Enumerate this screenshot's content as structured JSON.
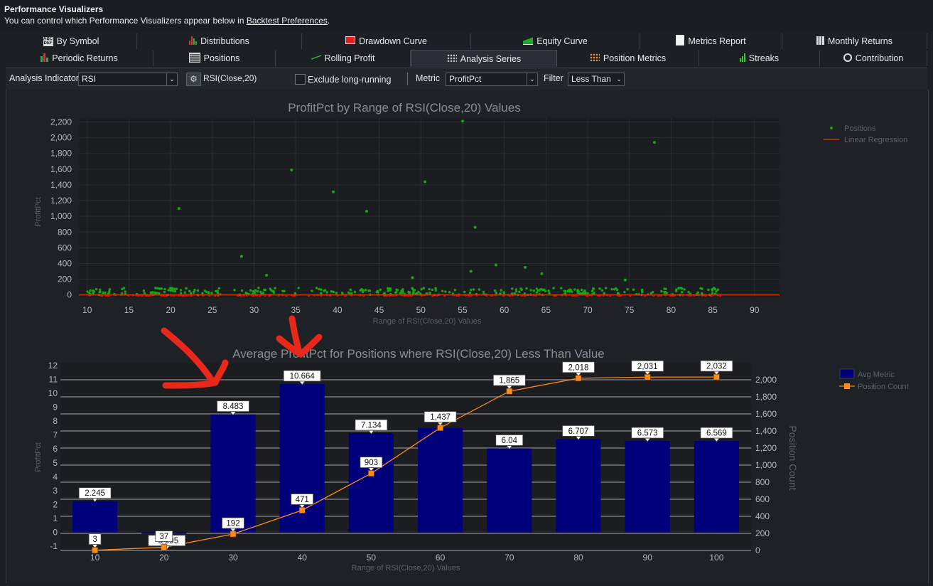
{
  "header": {
    "title": "Performance Visualizers",
    "subtitle_prefix": "You can control which Performance Visualizers appear below in ",
    "subtitle_link": "Backtest Preferences",
    "subtitle_suffix": "."
  },
  "tabs_row1": [
    {
      "label": "By Symbol",
      "icon": "abc-def-icon"
    },
    {
      "label": "Distributions",
      "icon": "bar-chart-icon"
    },
    {
      "label": "Drawdown Curve",
      "icon": "drawdown-icon"
    },
    {
      "label": "Equity Curve",
      "icon": "equity-curve-icon"
    },
    {
      "label": "Metrics Report",
      "icon": "document-icon"
    },
    {
      "label": "Monthly Returns",
      "icon": "calendar-columns-icon"
    }
  ],
  "tabs_row2": [
    {
      "label": "Periodic Returns",
      "icon": "periodic-returns-icon"
    },
    {
      "label": "Positions",
      "icon": "table-icon"
    },
    {
      "label": "Rolling Profit",
      "icon": "rolling-profit-icon"
    },
    {
      "label": "Analysis Series",
      "icon": "analysis-series-icon"
    },
    {
      "label": "Position Metrics",
      "icon": "scatter-icon"
    },
    {
      "label": "Streaks",
      "icon": "streaks-icon"
    },
    {
      "label": "Contribution",
      "icon": "pie-icon"
    }
  ],
  "toolbar": {
    "indicator_label": "Analysis Indicator",
    "indicator_value": "RSI",
    "indicator_desc": "RSI(Close,20)",
    "exclude_label": "Exclude long-running",
    "metric_label": "Metric",
    "metric_value": "ProfitPct",
    "filter_label": "Filter",
    "filter_value": "Less Than"
  },
  "colors": {
    "bar": "#00007a",
    "scatter": "#11aa11",
    "scatter_neg": "#cc1111",
    "regression": "#cc3300",
    "count_line": "#ff8c1a",
    "annotation": "#e8281a"
  },
  "chart_data": [
    {
      "type": "scatter",
      "title": "ProfitPct by Range of RSI(Close,20) Values",
      "xlabel": "Range of RSI(Close,20) Values",
      "ylabel": "ProfitPct",
      "xlim": [
        9,
        93
      ],
      "ylim": [
        -30,
        2250
      ],
      "xticks": [
        10,
        15,
        20,
        25,
        30,
        35,
        40,
        45,
        50,
        55,
        60,
        65,
        70,
        75,
        80,
        85,
        90
      ],
      "yticks": [
        0,
        200,
        400,
        600,
        800,
        1000,
        1200,
        1400,
        1600,
        1800,
        2000,
        2200
      ],
      "legend": [
        "Positions",
        "Linear Regression"
      ],
      "legend_placement": "top-right",
      "outliers": [
        {
          "x": 21,
          "y": 1100
        },
        {
          "x": 28.5,
          "y": 490
        },
        {
          "x": 31.5,
          "y": 250
        },
        {
          "x": 34.5,
          "y": 1590
        },
        {
          "x": 39.5,
          "y": 1310
        },
        {
          "x": 43.5,
          "y": 1065
        },
        {
          "x": 50.5,
          "y": 1440
        },
        {
          "x": 55,
          "y": 2210
        },
        {
          "x": 56.5,
          "y": 860
        },
        {
          "x": 59,
          "y": 380
        },
        {
          "x": 62.5,
          "y": 350
        },
        {
          "x": 78,
          "y": 1940
        },
        {
          "x": 56,
          "y": 300
        },
        {
          "x": 64.5,
          "y": 270
        },
        {
          "x": 74.5,
          "y": 190
        },
        {
          "x": 49,
          "y": 220
        }
      ],
      "regression": {
        "x": [
          9,
          93
        ],
        "y": [
          0,
          0
        ]
      }
    },
    {
      "type": "bar",
      "title": "Average ProfitPct for Positions where RSI(Close,20) Less Than Value",
      "xlabel": "Range of RSI(Close,20) Values",
      "ylabel": "ProfitPct",
      "y2label": "Position Count",
      "categories": [
        "10",
        "20",
        "30",
        "40",
        "50",
        "60",
        "70",
        "80",
        "90",
        "100"
      ],
      "series": [
        {
          "name": "Avg Metric",
          "values": [
            2.245,
            -0.095,
            8.483,
            10.664,
            7.134,
            7.5,
            6.04,
            6.707,
            6.573,
            6.569
          ]
        },
        {
          "name": "Position Count",
          "values": [
            3,
            37,
            192,
            471,
            903,
            1437,
            1865,
            2018,
            2031,
            2032
          ]
        }
      ],
      "bar_labels": [
        "2.245",
        "-0.095",
        "8.483",
        "10.664",
        "7.134",
        "",
        "6.04",
        "6.707",
        "6.573",
        "6.569"
      ],
      "count_labels": [
        "3",
        "37",
        "192",
        "471",
        "903",
        "1,437",
        "1,865",
        "2,018",
        "2,031",
        "2,032"
      ],
      "ylim": [
        -1.3,
        12.2
      ],
      "y2lim": [
        0,
        2200
      ],
      "yticks": [
        -1,
        0,
        1,
        2,
        3,
        4,
        5,
        6,
        7,
        8,
        9,
        10,
        11,
        12
      ],
      "y2ticks": [
        0,
        200,
        400,
        600,
        800,
        1000,
        1200,
        1400,
        1600,
        1800,
        2000
      ],
      "legend_placement": "top-right"
    }
  ]
}
